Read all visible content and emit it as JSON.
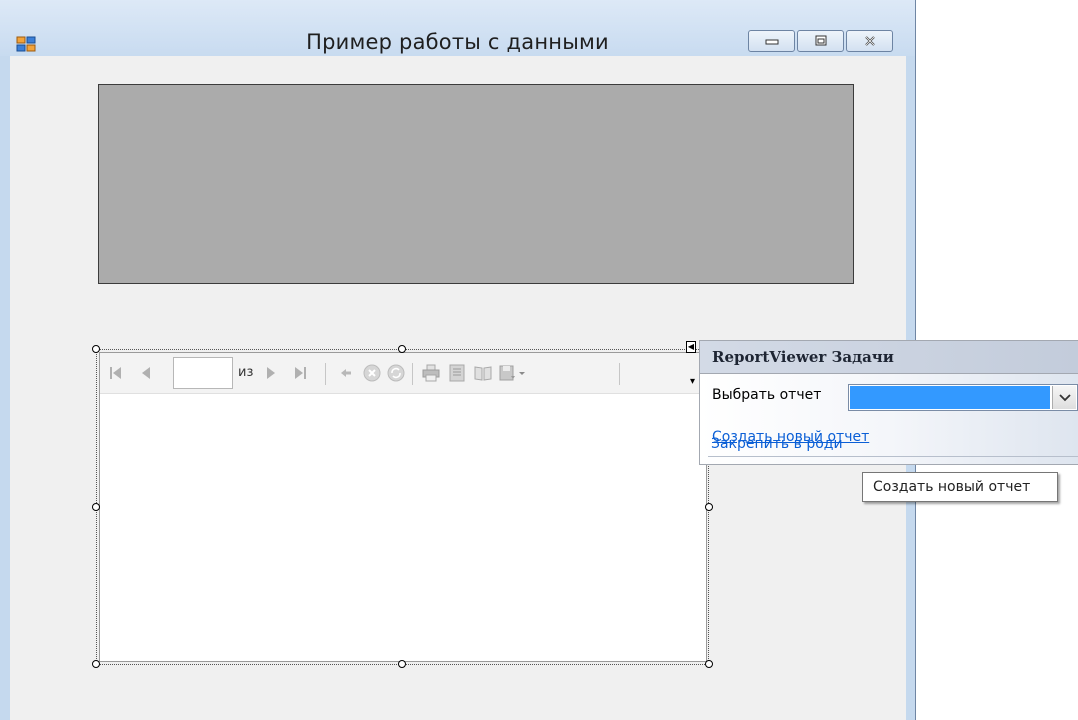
{
  "window": {
    "title": "Пример работы с данными",
    "accent": "#c5d9ee"
  },
  "icons": {
    "app": "form-app-icon",
    "minimize": "minimize-icon",
    "maximize": "maximize-icon",
    "close": "close-icon"
  },
  "report_toolbar": {
    "page_value": "",
    "of_label": "из",
    "icons": [
      "first-page-icon",
      "previous-page-icon",
      "next-page-icon",
      "last-page-icon",
      "back-icon",
      "stop-icon",
      "refresh-icon",
      "print-icon",
      "print-layout-icon",
      "page-setup-icon",
      "export-icon"
    ]
  },
  "tasks": {
    "header": "ReportViewer Задачи",
    "choose_report_label": "Выбрать отчет",
    "selected_report": "",
    "create_link": "Создать новый отчет",
    "dock_link": "Закрепить в роди",
    "tooltip": "Создать новый отчет"
  }
}
